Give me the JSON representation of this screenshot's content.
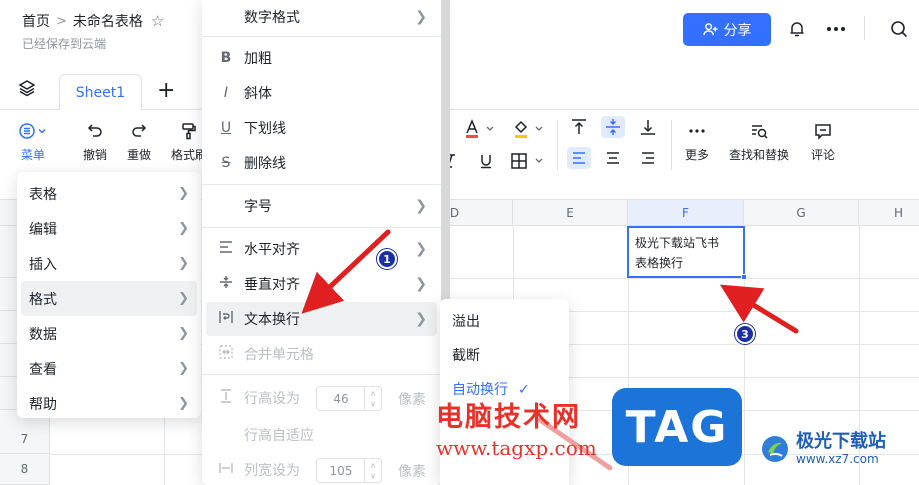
{
  "header": {
    "breadcrumb_home": "首页",
    "breadcrumb_sep": ">",
    "doc_title": "未命名表格",
    "saved_status": "已经保存到云端",
    "share_label": "分享"
  },
  "tabs": {
    "sheet1": "Sheet1",
    "add": "+"
  },
  "toolbar": {
    "menu": "菜单",
    "undo": "撤销",
    "redo": "重做",
    "format_painter": "格式刷",
    "more": "更多",
    "find_replace": "查找和替换",
    "comment": "评论"
  },
  "grid": {
    "columns": [
      "D",
      "E",
      "F",
      "G",
      "H"
    ],
    "rows": [
      "7",
      "8"
    ],
    "active_cell_text": "极光下载站飞书表格换行"
  },
  "main_menu": {
    "items": [
      {
        "label": "表格"
      },
      {
        "label": "编辑"
      },
      {
        "label": "插入"
      },
      {
        "label": "格式"
      },
      {
        "label": "数据"
      },
      {
        "label": "查看"
      },
      {
        "label": "帮助"
      }
    ]
  },
  "format_menu": {
    "number_format": "数字格式",
    "bold": "加粗",
    "italic": "斜体",
    "underline": "下划线",
    "strikethrough": "删除线",
    "font_size": "字号",
    "h_align": "水平对齐",
    "v_align": "垂直对齐",
    "text_wrap": "文本换行",
    "merge_cells": "合并单元格",
    "row_height_label": "行高设为",
    "row_height_value": "46",
    "row_height_unit": "像素",
    "row_auto_fit": "行高自适应",
    "col_width_label": "列宽设为",
    "col_width_value": "105",
    "col_width_unit": "像素"
  },
  "wrap_submenu": {
    "overflow": "溢出",
    "clip": "截断",
    "auto_wrap": "自动换行"
  },
  "annotations": {
    "badge1": "1",
    "badge3": "3"
  },
  "watermark": {
    "site_cn": "电脑技术网",
    "url": "www.tagxp.com",
    "tag": "TAG",
    "logo_text": "极光下载站",
    "logo_url": "www.xz7.com"
  },
  "colors": {
    "accent": "#3370ff",
    "arrow": "#e02020",
    "badge": "#1b2ea8"
  }
}
